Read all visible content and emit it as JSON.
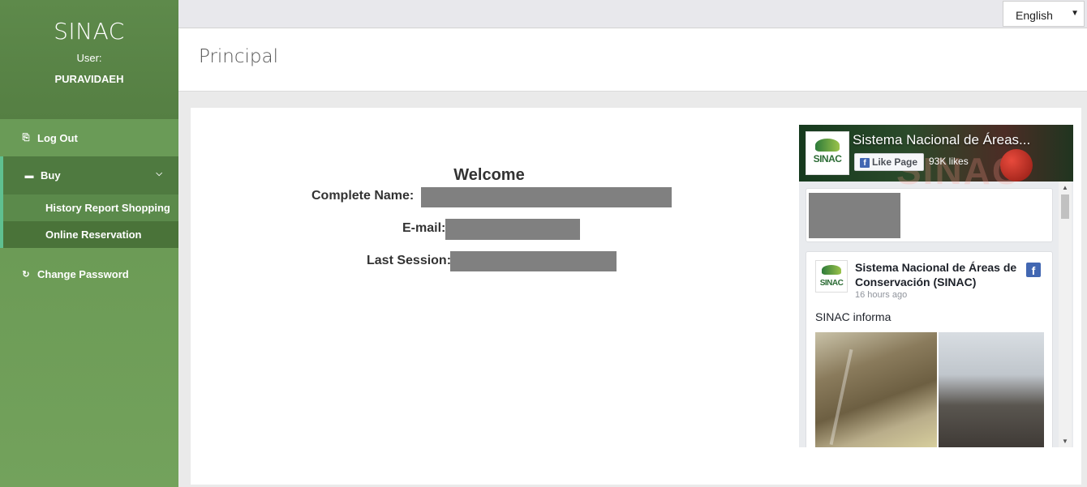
{
  "sidebar": {
    "app_name": "SINAC",
    "user_label": "User:",
    "username": "PURAVIDAEH",
    "logout": "Log Out",
    "buy": "Buy",
    "buy_sub": [
      "History Report Shopping",
      "Online Reservation"
    ],
    "change_password": "Change Password"
  },
  "topbar": {
    "language": "English"
  },
  "header": {
    "title": "Principal"
  },
  "welcome": {
    "title": "Welcome",
    "complete_name_label": "Complete Name:",
    "email_label": "E-mail:",
    "last_session_label": "Last Session:"
  },
  "facebook": {
    "page_name": "Sistema Nacional de Áreas...",
    "like_button": "Like Page",
    "likes": "93K likes",
    "logo_text": "SINAC",
    "post_author": "Sistema Nacional de Áreas de Conservación (SINAC)",
    "post_time": "16 hours ago",
    "post_text": "SINAC informa"
  },
  "colors": {
    "sidebar_green": "#6b9a55",
    "sidebar_active": "#4f7a40",
    "accent_bar": "#5fc090",
    "facebook_blue": "#4267b2"
  }
}
